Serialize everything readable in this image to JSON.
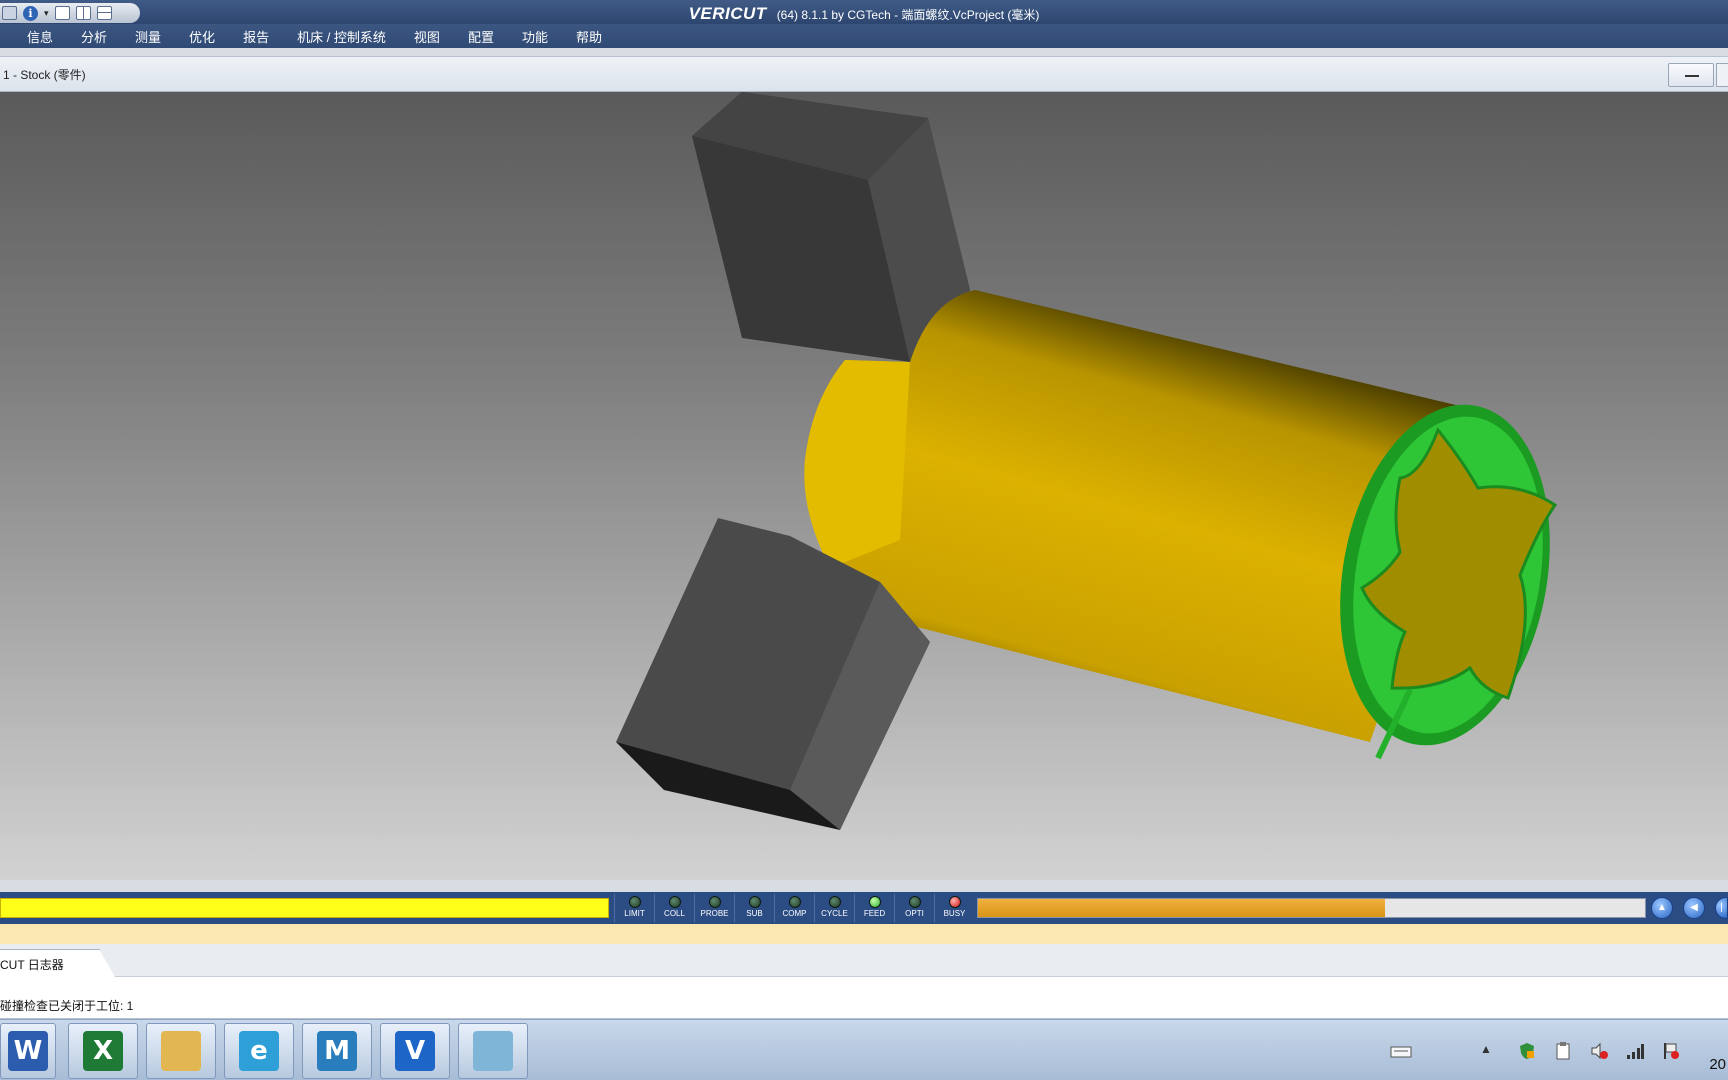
{
  "window": {
    "logo": "VERICUT",
    "title": "(64)  8.1.1 by CGTech - 端面螺纹.VcProject (毫米)"
  },
  "menu": [
    "信息",
    "分析",
    "测量",
    "优化",
    "报告",
    "机床 / 控制系统",
    "视图",
    "配置",
    "功能",
    "帮助"
  ],
  "viewport": {
    "title": "1 - Stock (零件)",
    "scene_colors": {
      "stock": "#d4aa00",
      "jaw": "#4a4a4a",
      "toolpath": "#25b52a",
      "cut_face": "#a38f00"
    }
  },
  "status": {
    "leds": [
      {
        "label": "LIMIT",
        "state": "off"
      },
      {
        "label": "COLL",
        "state": "off"
      },
      {
        "label": "PROBE",
        "state": "off"
      },
      {
        "label": "SUB",
        "state": "off"
      },
      {
        "label": "COMP",
        "state": "off"
      },
      {
        "label": "CYCLE",
        "state": "off"
      },
      {
        "label": "FEED",
        "state": "on"
      },
      {
        "label": "OPTI",
        "state": "off"
      },
      {
        "label": "BUSY",
        "state": "busy"
      }
    ],
    "progress_fraction": 0.61
  },
  "log": {
    "tab_label": "CUT 日志器",
    "line": "碰撞检查已关闭于工位: 1"
  },
  "taskbar": {
    "apps": [
      {
        "name": "word",
        "glyph": "W",
        "color": "#2b5cae"
      },
      {
        "name": "excel",
        "glyph": "X",
        "color": "#1e7a34"
      },
      {
        "name": "explorer",
        "glyph": "",
        "color": "#e2b650"
      },
      {
        "name": "ie",
        "glyph": "e",
        "color": "#2f9fd8"
      },
      {
        "name": "mastercam",
        "glyph": "M",
        "color": "#2a7dbd"
      },
      {
        "name": "vericut",
        "glyph": "V",
        "color": "#1d66c8"
      },
      {
        "name": "notepad",
        "glyph": "",
        "color": "#7fb6d8"
      }
    ],
    "clock": "20"
  }
}
